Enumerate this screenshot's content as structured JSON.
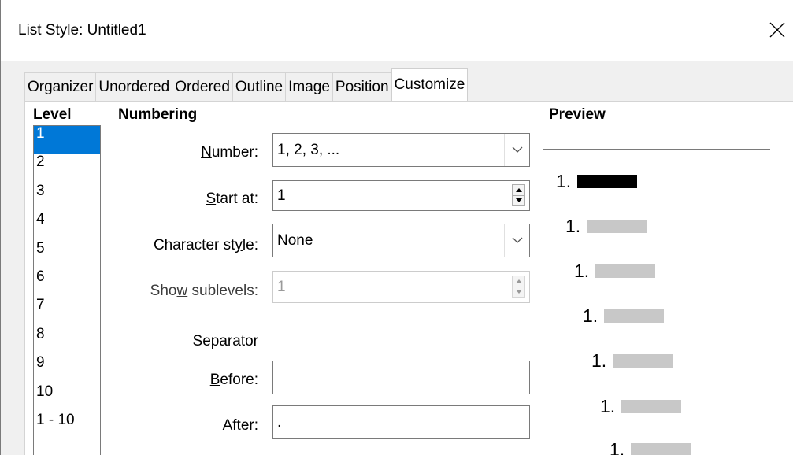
{
  "window": {
    "title": "List Style: Untitled1",
    "close_icon": "close-icon"
  },
  "tabs": [
    {
      "label": "Organizer"
    },
    {
      "label": "Unordered"
    },
    {
      "label": "Ordered"
    },
    {
      "label": "Outline"
    },
    {
      "label": "Image"
    },
    {
      "label": "Position"
    },
    {
      "label": "Customize",
      "active": true
    }
  ],
  "level": {
    "heading": {
      "mnemonic": "L",
      "rest": "evel"
    },
    "items": [
      "1",
      "2",
      "3",
      "4",
      "5",
      "6",
      "7",
      "8",
      "9",
      "10",
      "1 - 10"
    ],
    "selected": "1"
  },
  "numbering": {
    "heading": "Numbering",
    "number": {
      "label_pre": "",
      "mnemonic": "N",
      "label_post": "umber:",
      "value": "1, 2, 3, ..."
    },
    "start_at": {
      "label_pre": "",
      "mnemonic": "S",
      "label_post": "tart at:",
      "value": "1"
    },
    "character_style": {
      "label_pre": "Character st",
      "mnemonic": "y",
      "label_post": "le:",
      "value": "None"
    },
    "show_sublevels": {
      "label_pre": "Sho",
      "mnemonic": "w",
      "label_post": " sublevels:",
      "value": "1",
      "disabled": true
    },
    "separator_label": "Separator",
    "before": {
      "label_pre": "",
      "mnemonic": "B",
      "label_post": "efore:",
      "value": ""
    },
    "after": {
      "label_pre": "",
      "mnemonic": "A",
      "label_post": "fter:",
      "value": "."
    }
  },
  "preview": {
    "heading": "Preview",
    "lines": [
      {
        "num": "1.",
        "bar_color": "#000000"
      },
      {
        "num": "1.",
        "bar_color": "#c8c8c8"
      },
      {
        "num": "1.",
        "bar_color": "#c8c8c8"
      },
      {
        "num": "1.",
        "bar_color": "#c8c8c8"
      },
      {
        "num": "1.",
        "bar_color": "#c8c8c8"
      },
      {
        "num": "1.",
        "bar_color": "#c8c8c8"
      },
      {
        "num": "1.",
        "bar_color": "#c8c8c8"
      }
    ]
  },
  "colors": {
    "selection": "#0078d7",
    "border": "#7a7a7a",
    "panel_bg": "#f0f0f0"
  }
}
